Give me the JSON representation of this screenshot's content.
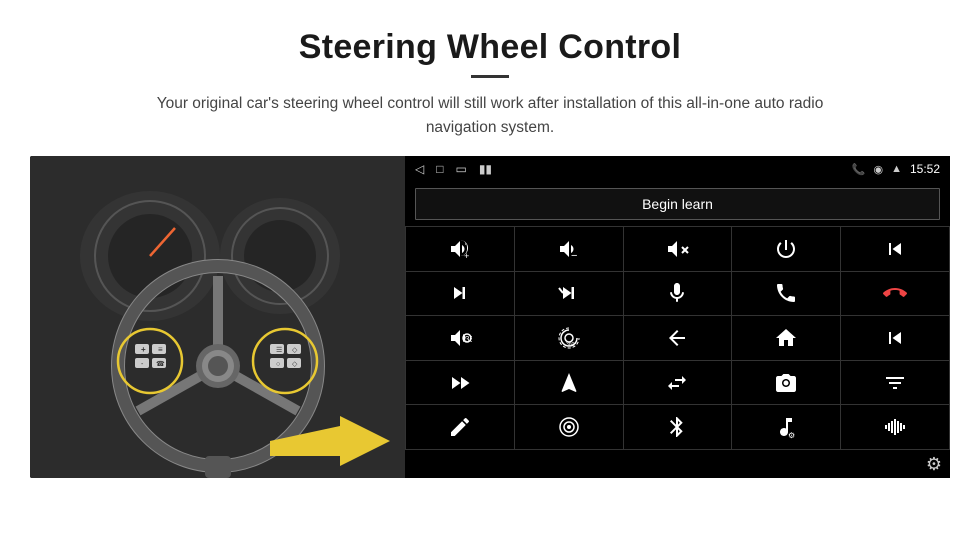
{
  "header": {
    "title": "Steering Wheel Control",
    "subtitle": "Your original car's steering wheel control will still work after installation of this all-in-one auto radio navigation system."
  },
  "status_bar": {
    "time": "15:52"
  },
  "begin_learn": {
    "button_label": "Begin learn"
  },
  "controls": [
    {
      "id": "vol-up",
      "icon": "vol_up",
      "symbol": "🔈+"
    },
    {
      "id": "vol-down",
      "icon": "vol_down",
      "symbol": "🔈−"
    },
    {
      "id": "mute",
      "icon": "mute",
      "symbol": "🔇"
    },
    {
      "id": "power",
      "icon": "power",
      "symbol": "⏻"
    },
    {
      "id": "prev-track",
      "icon": "prev_track",
      "symbol": "⏮"
    },
    {
      "id": "skip-next",
      "icon": "skip_next",
      "symbol": "⏭"
    },
    {
      "id": "shuffle-next",
      "icon": "shuffle_next",
      "symbol": "⏭"
    },
    {
      "id": "mic",
      "icon": "mic",
      "symbol": "🎤"
    },
    {
      "id": "phone",
      "icon": "phone",
      "symbol": "📞"
    },
    {
      "id": "hang-up",
      "icon": "hang_up",
      "symbol": "📵"
    },
    {
      "id": "horn",
      "icon": "horn",
      "symbol": "📢"
    },
    {
      "id": "360-view",
      "icon": "360_view",
      "symbol": "👁"
    },
    {
      "id": "back",
      "icon": "back",
      "symbol": "↩"
    },
    {
      "id": "home",
      "icon": "home",
      "symbol": "⌂"
    },
    {
      "id": "skip-back",
      "icon": "skip_back",
      "symbol": "⏮"
    },
    {
      "id": "fast-forward",
      "icon": "fast_forward",
      "symbol": "⏩"
    },
    {
      "id": "navigate",
      "icon": "navigate",
      "symbol": "➤"
    },
    {
      "id": "swap",
      "icon": "swap",
      "symbol": "⇄"
    },
    {
      "id": "media",
      "icon": "media",
      "symbol": "📷"
    },
    {
      "id": "sliders",
      "icon": "sliders",
      "symbol": "🎚"
    },
    {
      "id": "edit",
      "icon": "edit",
      "symbol": "✏"
    },
    {
      "id": "target",
      "icon": "target",
      "symbol": "🎯"
    },
    {
      "id": "bluetooth",
      "icon": "bluetooth",
      "symbol": "⚡"
    },
    {
      "id": "music-settings",
      "icon": "music_settings",
      "symbol": "🎵"
    },
    {
      "id": "waveform",
      "icon": "waveform",
      "symbol": "〰"
    }
  ],
  "settings_icon": "⚙"
}
